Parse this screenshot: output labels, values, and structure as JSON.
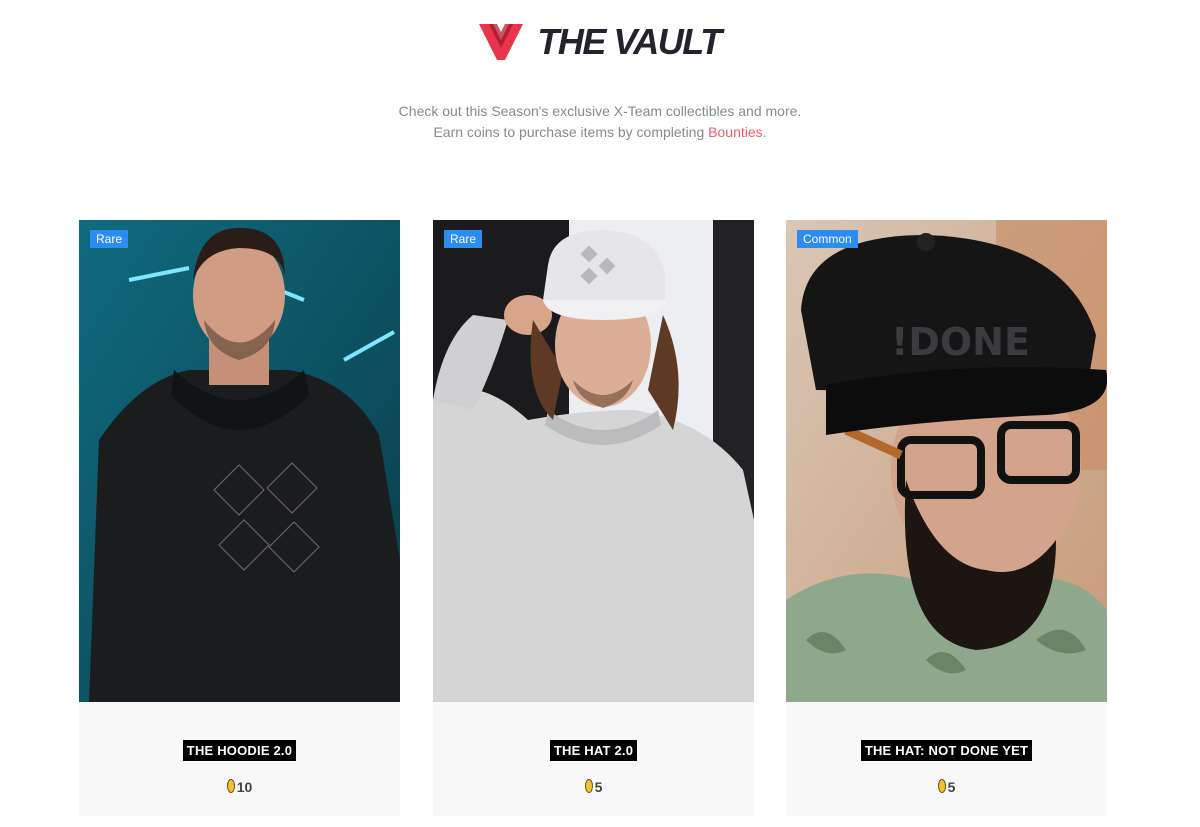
{
  "header": {
    "title": "THE VAULT",
    "brand_color": "#e8354a"
  },
  "intro": {
    "line1": "Check out this Season's exclusive X-Team collectibles and more.",
    "line2_prefix": "Earn coins to purchase items by completing ",
    "line2_link": "Bounties",
    "line2_suffix": "."
  },
  "items": [
    {
      "rarity": "Rare",
      "name": "THE HOODIE 2.0",
      "price": "10",
      "rarity_color": "#2b8cf2"
    },
    {
      "rarity": "Rare",
      "name": "THE HAT 2.0",
      "price": "5",
      "rarity_color": "#2b8cf2"
    },
    {
      "rarity": "Common",
      "name": "THE HAT: NOT DONE YET",
      "price": "5",
      "rarity_color": "#2b8cf2"
    }
  ],
  "icons": {
    "logo": "x-team-logo-icon",
    "coin": "coin-icon"
  }
}
